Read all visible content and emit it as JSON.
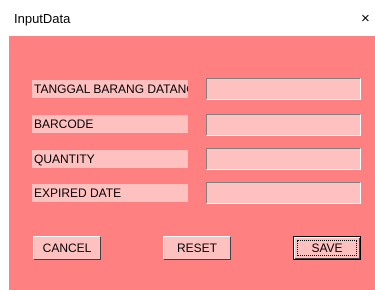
{
  "window": {
    "title": "InputData",
    "close_glyph": "×"
  },
  "form": {
    "fields": [
      {
        "label": "TANGGAL BARANG DATANG",
        "value": ""
      },
      {
        "label": "BARCODE",
        "value": ""
      },
      {
        "label": "QUANTITY",
        "value": ""
      },
      {
        "label": "EXPIRED DATE",
        "value": ""
      }
    ]
  },
  "buttons": {
    "cancel_label": "CANCEL",
    "reset_label": "RESET",
    "save_label": "SAVE"
  },
  "colors": {
    "form_background": "#ff8080",
    "control_background": "#ffc0c0",
    "titlebar_background": "#ffffff"
  }
}
